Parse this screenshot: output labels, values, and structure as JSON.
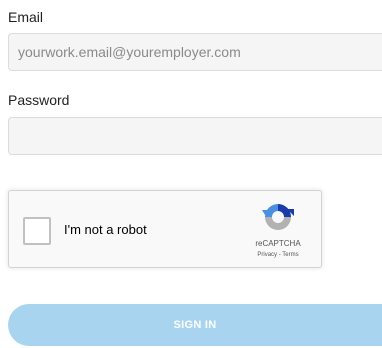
{
  "form": {
    "email_label": "Email",
    "email_placeholder": "yourwork.email@youremployer.com",
    "email_value": "",
    "password_label": "Password",
    "password_placeholder": "",
    "password_value": ""
  },
  "recaptcha": {
    "checkbox_label": "I'm not a robot",
    "brand": "reCAPTCHA",
    "privacy_link": "Privacy",
    "separator": " - ",
    "terms_link": "Terms",
    "logo_icon": "recaptcha-logo-icon",
    "checked": false
  },
  "actions": {
    "signin_label": "SIGN IN"
  },
  "colors": {
    "signin_background": "#a8d4ef",
    "recaptcha_blue": "#1c3aa9",
    "recaptcha_lightblue": "#4a90e2",
    "recaptcha_gray": "#b2b2b2"
  }
}
